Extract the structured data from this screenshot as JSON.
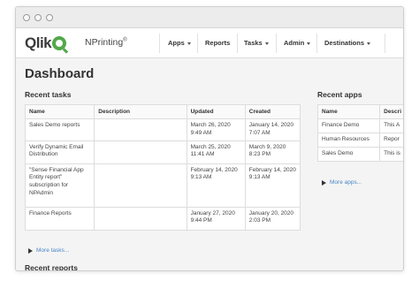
{
  "brand": {
    "logo_text": "Qlik",
    "logo_mark": "Q",
    "product": "NPrinting",
    "product_mark": "®"
  },
  "nav": {
    "items": [
      {
        "label": "Apps",
        "dropdown": true
      },
      {
        "label": "Reports",
        "dropdown": false
      },
      {
        "label": "Tasks",
        "dropdown": true
      },
      {
        "label": "Admin",
        "dropdown": true
      },
      {
        "label": "Destinations",
        "dropdown": true
      }
    ]
  },
  "page": {
    "title": "Dashboard"
  },
  "recent_tasks": {
    "title": "Recent tasks",
    "columns": [
      "Name",
      "Description",
      "Updated",
      "Created"
    ],
    "rows": [
      {
        "name": "Sales Demo reports",
        "description": "",
        "updated": "March 26, 2020 9:49 AM",
        "created": "January 14, 2020 7:07 AM"
      },
      {
        "name": "Verify Dynamic Email Distribution",
        "description": "",
        "updated": "March 25, 2020 11:41 AM",
        "created": "March 9, 2020 8:23 PM"
      },
      {
        "name": "\"Sense Financial App Entity report\" subscription for NPAdmin",
        "description": "",
        "updated": "February 14, 2020 9:13 AM",
        "created": "February 14, 2020 9:13 AM"
      },
      {
        "name": "Finance Reports",
        "description": "",
        "updated": "January 27, 2020 9:44 PM",
        "created": "January 20, 2020 2:03 PM"
      }
    ],
    "more_label": "More tasks..."
  },
  "recent_apps": {
    "title": "Recent apps",
    "columns": [
      "Name",
      "Descri"
    ],
    "rows": [
      {
        "name": "Finance Demo",
        "description": "This A"
      },
      {
        "name": "Human Resources",
        "description": "Repor"
      },
      {
        "name": "Sales Demo",
        "description": "This is"
      }
    ],
    "more_label": "More apps..."
  },
  "recent_reports": {
    "title": "Recent reports"
  },
  "colors": {
    "accent_green": "#52a84a",
    "link_blue": "#4a86c6",
    "background": "#f4f4f4"
  }
}
